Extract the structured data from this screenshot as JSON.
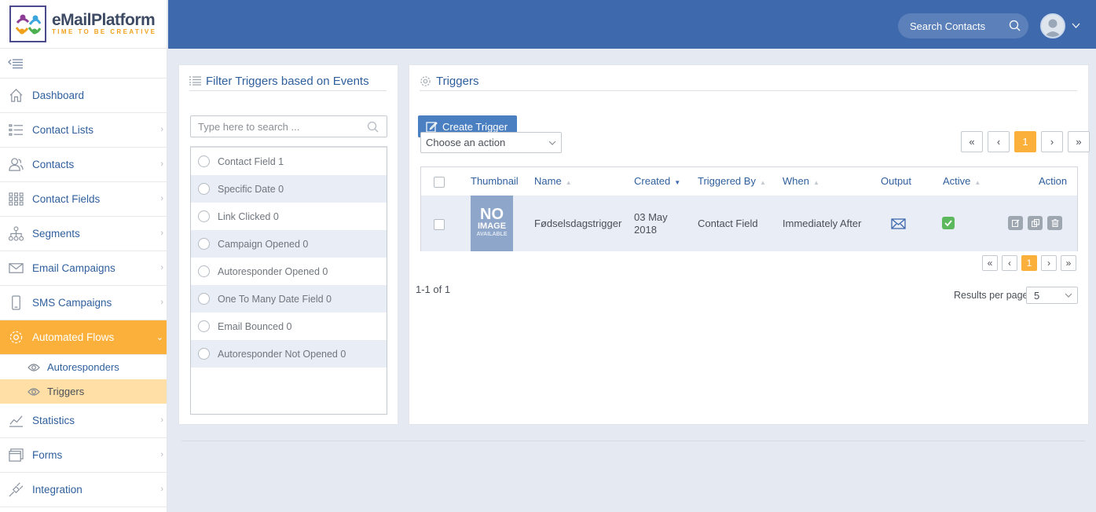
{
  "brand": {
    "name": "eMailPlatform",
    "tagline": "TIME TO BE CREATIVE"
  },
  "sidebar": {
    "items": [
      {
        "label": "Dashboard",
        "icon": "home-icon"
      },
      {
        "label": "Contact Lists",
        "icon": "list-icon"
      },
      {
        "label": "Contacts",
        "icon": "users-icon"
      },
      {
        "label": "Contact Fields",
        "icon": "grid-icon"
      },
      {
        "label": "Segments",
        "icon": "sitemap-icon"
      },
      {
        "label": "Email Campaigns",
        "icon": "envelope-icon"
      },
      {
        "label": "SMS Campaigns",
        "icon": "phone-icon"
      },
      {
        "label": "Automated Flows",
        "icon": "gear-icon"
      },
      {
        "label": "Statistics",
        "icon": "line-chart-icon"
      },
      {
        "label": "Forms",
        "icon": "forms-icon"
      },
      {
        "label": "Integration",
        "icon": "plug-icon"
      }
    ],
    "sub_items": [
      {
        "label": "Autoresponders",
        "icon": "eye-icon"
      },
      {
        "label": "Triggers",
        "icon": "eye-icon"
      }
    ]
  },
  "topbar": {
    "search_placeholder": "Search Contacts"
  },
  "filter_panel": {
    "title": "Filter Triggers based on Events",
    "search_placeholder": "Type here to search ...",
    "events": [
      "Contact Field 1",
      "Specific Date 0",
      "Link Clicked 0",
      "Campaign Opened 0",
      "Autoresponder Opened 0",
      "One To Many Date Field 0",
      "Email Bounced 0",
      "Autoresponder Not Opened 0"
    ]
  },
  "triggers_panel": {
    "title": "Triggers",
    "create_label": "Create Trigger",
    "action_select": "Choose an action",
    "pager": {
      "first": "«",
      "prev": "‹",
      "current": "1",
      "next": "›",
      "last": "»"
    },
    "columns": {
      "thumbnail": "Thumbnail",
      "name": "Name",
      "created": "Created",
      "triggered_by": "Triggered By",
      "when": "When",
      "output": "Output",
      "active": "Active",
      "action": "Action"
    },
    "rows": [
      {
        "thumbnail": {
          "big": "NO",
          "mid": "IMAGE",
          "small": "AVAILABLE"
        },
        "name": "Fødselsdagstrigger",
        "created_line1": "03 May",
        "created_line2": "2018",
        "triggered_by": "Contact Field",
        "when": "Immediately After",
        "output": "envelope-icon",
        "active": true
      }
    ],
    "summary": "1-1 of 1",
    "results_per_page_label": "Results per page",
    "results_per_page": "5"
  },
  "colors": {
    "topbar": "#3e69ad",
    "accent": "#fbb03b",
    "link": "#2f5f9c",
    "active_green": "#5cb85c"
  }
}
